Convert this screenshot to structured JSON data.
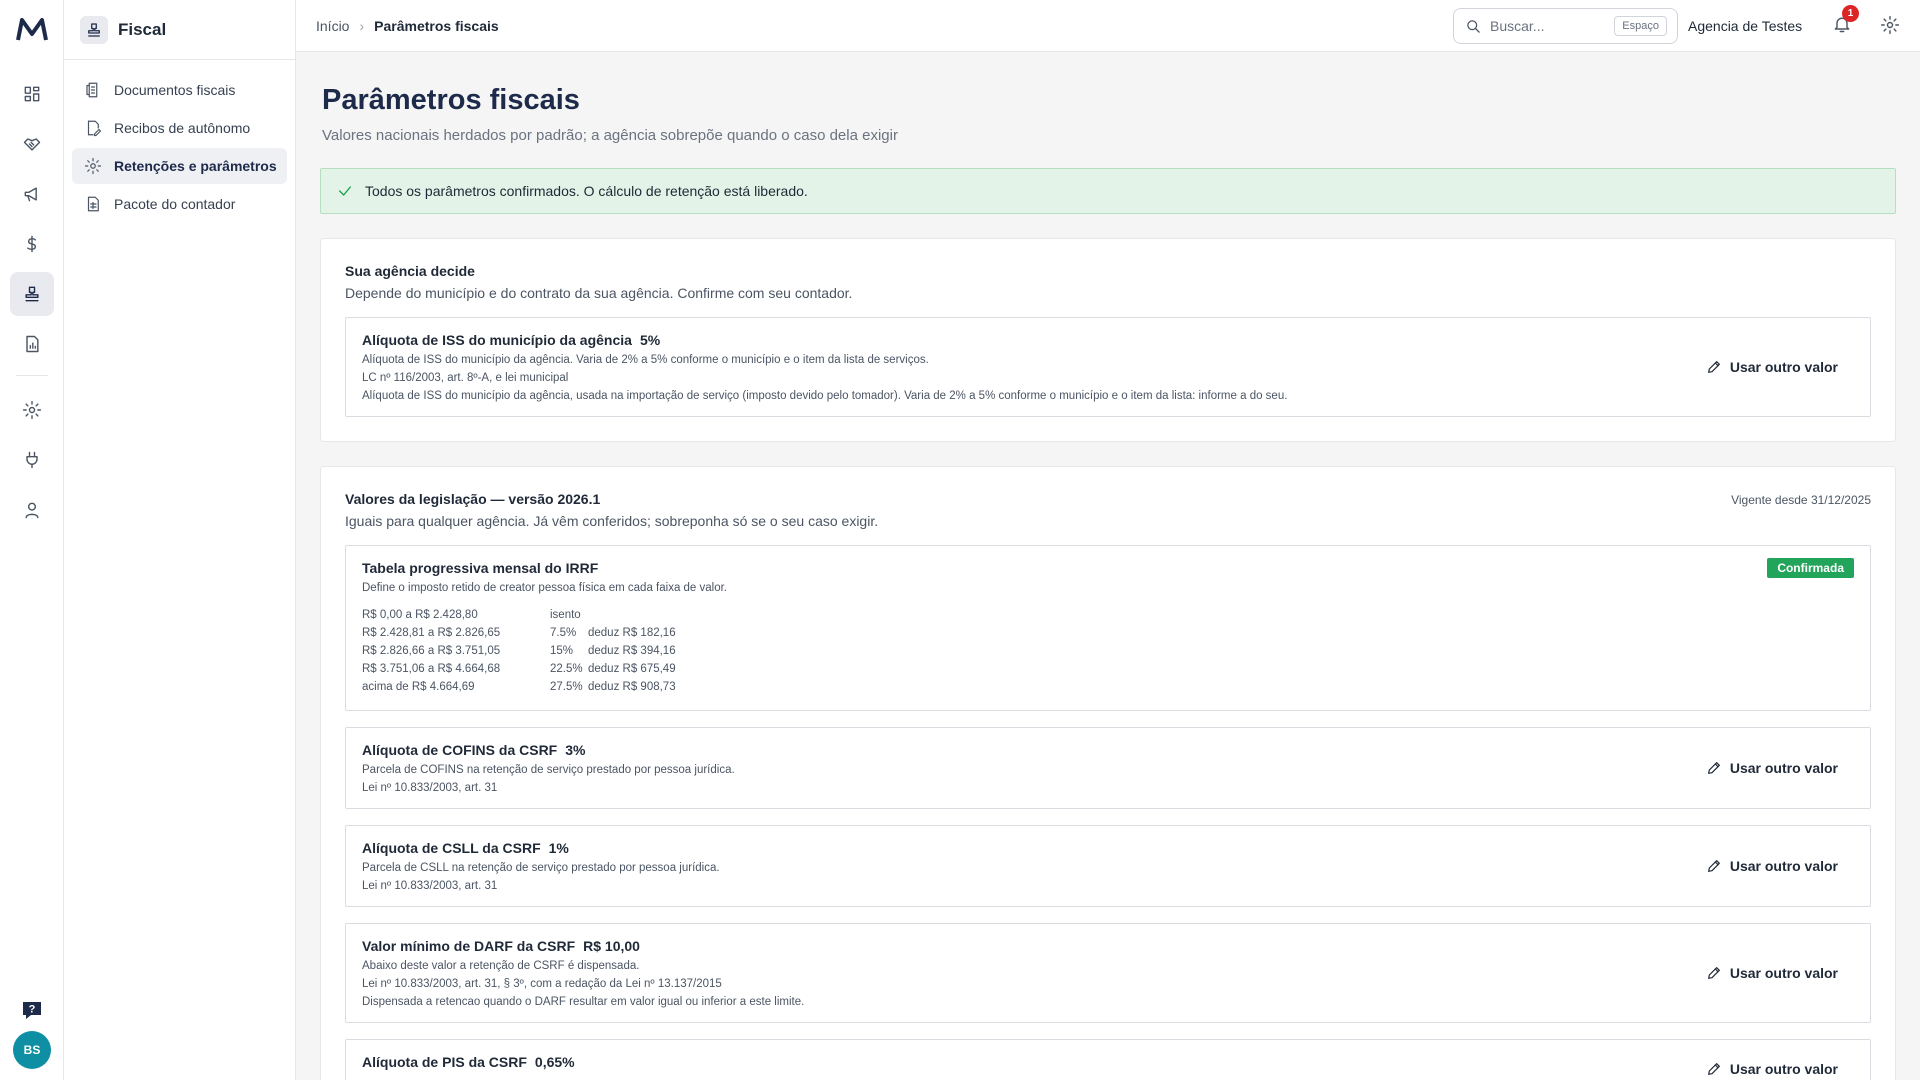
{
  "rail": {
    "items": [
      "dashboard-icon",
      "handshake-icon",
      "megaphone-icon",
      "dollar-icon",
      "stamp-icon",
      "report-icon",
      "gear-icon",
      "plug-icon",
      "user-icon"
    ],
    "avatar_initials": "BS"
  },
  "sidebar": {
    "title": "Fiscal",
    "items": [
      {
        "label": "Documentos fiscais"
      },
      {
        "label": "Recibos de autônomo"
      },
      {
        "label": "Retenções e parâmetros"
      },
      {
        "label": "Pacote do contador"
      }
    ]
  },
  "topbar": {
    "breadcrumb": {
      "home": "Início",
      "current": "Parâmetros fiscais"
    },
    "search_placeholder": "Buscar...",
    "search_shortcut": "Espaço",
    "agency": "Agencia de Testes",
    "notifications": "1"
  },
  "page": {
    "title": "Parâmetros fiscais",
    "subtitle": "Valores nacionais herdados por padrão; a agência sobrepõe quando o caso dela exigir",
    "alert": "Todos os parâmetros confirmados. O cálculo de retenção está liberado."
  },
  "agency_section": {
    "title": "Sua agência decide",
    "desc": "Depende do município e do contrato da sua agência. Confirme com seu contador.",
    "cards": [
      {
        "title": "Alíquota de ISS do município da agência",
        "value": "5%",
        "lines": [
          "Alíquota de ISS do município da agência. Varia de 2% a 5% conforme o município e o item da lista de serviços.",
          "LC nº 116/2003, art. 8º-A, e lei municipal",
          "Alíquota de ISS do município da agência, usada na importação de serviço (imposto devido pelo tomador). Varia de 2% a 5% conforme o município e o item da lista: informe a do seu."
        ],
        "action": "Usar outro valor"
      }
    ]
  },
  "law_section": {
    "title": "Valores da legislação — versão 2026.1",
    "desc": "Iguais para qualquer agência. Já vêm conferidos; sobreponha só se o seu caso exigir.",
    "date": "Vigente desde 31/12/2025",
    "irrf": {
      "title": "Tabela progressiva mensal do IRRF",
      "desc": "Define o imposto retido de creator pessoa física em cada faixa de valor.",
      "badge": "Confirmada",
      "rows": [
        {
          "range": "R$ 0,00 a R$ 2.428,80",
          "rate": "isento",
          "deduction": ""
        },
        {
          "range": "R$ 2.428,81 a R$ 2.826,65",
          "rate": "7.5%",
          "deduction": "deduz R$ 182,16"
        },
        {
          "range": "R$ 2.826,66 a R$ 3.751,05",
          "rate": "15%",
          "deduction": "deduz R$ 394,16"
        },
        {
          "range": "R$ 3.751,06 a R$ 4.664,68",
          "rate": "22.5%",
          "deduction": "deduz R$ 675,49"
        },
        {
          "range": "acima de R$ 4.664,69",
          "rate": "27.5%",
          "deduction": "deduz R$ 908,73"
        }
      ]
    },
    "cards": [
      {
        "title": "Alíquota de COFINS da CSRF",
        "value": "3%",
        "lines": [
          "Parcela de COFINS na retenção de serviço prestado por pessoa jurídica.",
          "Lei nº 10.833/2003, art. 31"
        ],
        "action": "Usar outro valor"
      },
      {
        "title": "Alíquota de CSLL da CSRF",
        "value": "1%",
        "lines": [
          "Parcela de CSLL na retenção de serviço prestado por pessoa jurídica.",
          "Lei nº 10.833/2003, art. 31"
        ],
        "action": "Usar outro valor"
      },
      {
        "title": "Valor mínimo de DARF da CSRF",
        "value": "R$ 10,00",
        "lines": [
          "Abaixo deste valor a retenção de CSRF é dispensada.",
          "Lei nº 10.833/2003, art. 31, § 3º, com a redação da Lei nº 13.137/2015",
          "Dispensada a retencao quando o DARF resultar em valor igual ou inferior a este limite."
        ],
        "action": "Usar outro valor"
      },
      {
        "title": "Alíquota de PIS da CSRF",
        "value": "0,65%",
        "lines": [],
        "action": "Usar outro valor"
      }
    ]
  }
}
